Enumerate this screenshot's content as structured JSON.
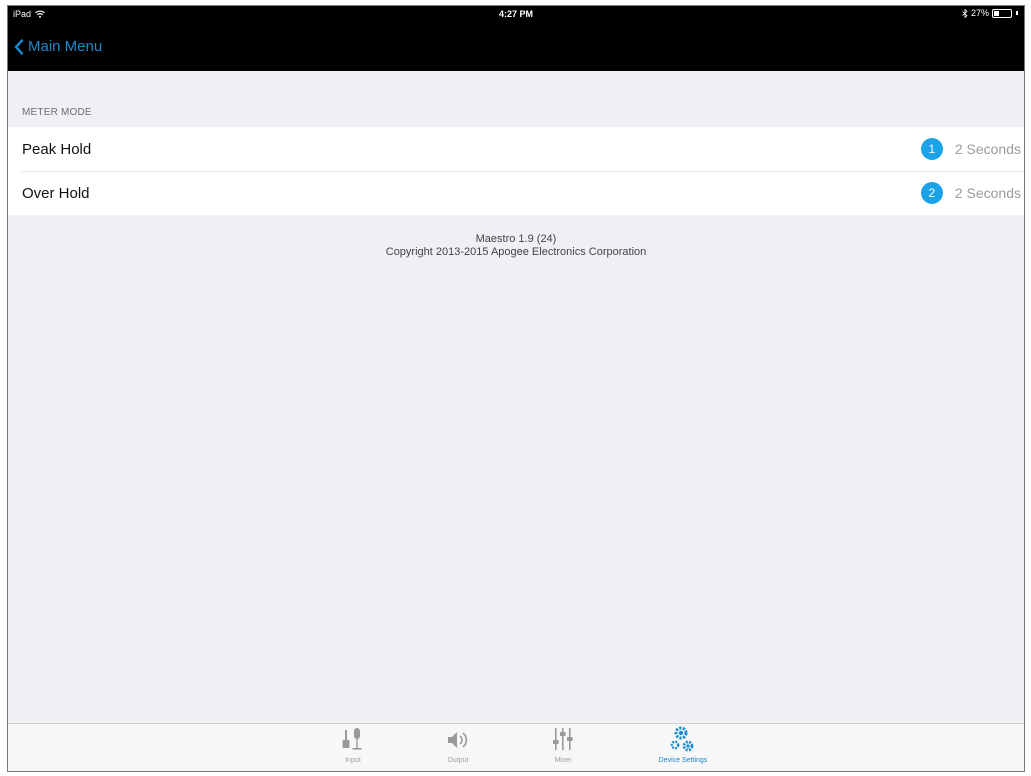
{
  "status_bar": {
    "device": "iPad",
    "time": "4:27 PM",
    "battery_text": "27%",
    "battery_level": 0.27
  },
  "nav": {
    "back_label": "Main Menu"
  },
  "section": {
    "header": "METER MODE",
    "rows": [
      {
        "label": "Peak Hold",
        "badge": "1",
        "value": "2 Seconds"
      },
      {
        "label": "Over Hold",
        "badge": "2",
        "value": "2 Seconds"
      }
    ]
  },
  "footer": {
    "version": "Maestro 1.9 (24)",
    "copyright": "Copyright 2013-2015 Apogee Electronics Corporation"
  },
  "tabs": [
    {
      "label": "Input",
      "icon": "microphone-icon",
      "active": false
    },
    {
      "label": "Output",
      "icon": "speaker-icon",
      "active": false
    },
    {
      "label": "Mixer",
      "icon": "mixer-faders-icon",
      "active": false
    },
    {
      "label": "Device Settings",
      "icon": "gears-icon",
      "active": true
    }
  ],
  "colors": {
    "accent": "#1a87c9",
    "badge": "#1aa3e8",
    "topbar": "#000000",
    "background": "#efeff4"
  }
}
